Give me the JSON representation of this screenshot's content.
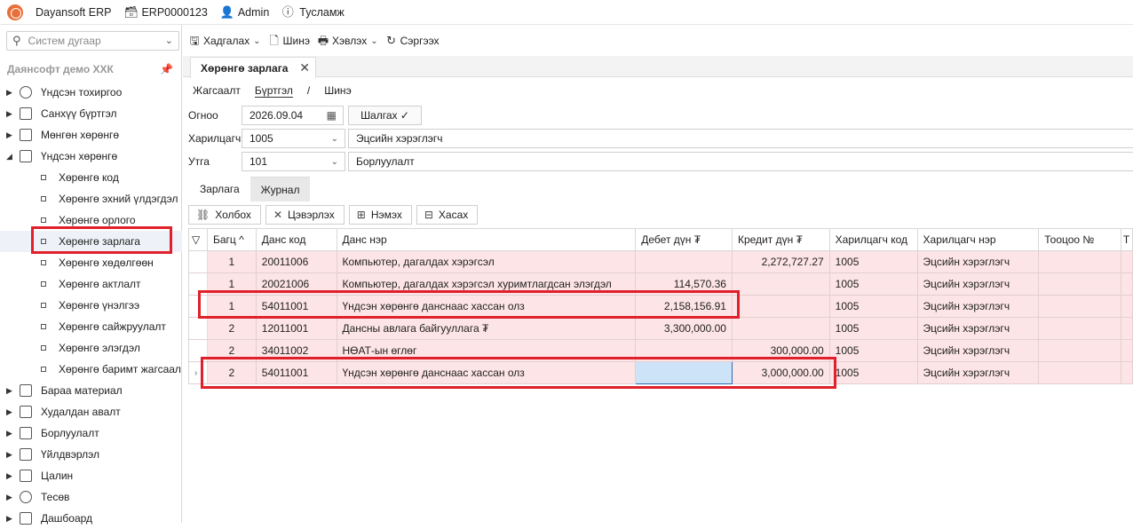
{
  "topbar": {
    "app": "Dayansoft ERP",
    "db": "ERP0000123",
    "user": "Admin",
    "help": "Тусламж"
  },
  "sidebar": {
    "search_placeholder": "Систем дугаар",
    "company": "Даянсофт демо ХХК",
    "items": [
      {
        "label": "Үндсэн тохиргоо"
      },
      {
        "label": "Санхүү бүртгэл"
      },
      {
        "label": "Мөнгөн хөрөнгө"
      },
      {
        "label": "Үндсэн хөрөнгө"
      }
    ],
    "children": [
      {
        "label": "Хөрөнгө код"
      },
      {
        "label": "Хөрөнгө эхний үлдэгдэл"
      },
      {
        "label": "Хөрөнгө орлого"
      },
      {
        "label": "Хөрөнгө зарлага"
      },
      {
        "label": "Хөрөнгө хөдөлгөөн"
      },
      {
        "label": "Хөрөнгө актлалт"
      },
      {
        "label": "Хөрөнгө үнэлгээ"
      },
      {
        "label": "Хөрөнгө сайжруулалт"
      },
      {
        "label": "Хөрөнгө элэгдэл"
      },
      {
        "label": "Хөрөнгө баримт жагсаал"
      }
    ],
    "items2": [
      {
        "label": "Бараа материал"
      },
      {
        "label": "Худалдан авалт"
      },
      {
        "label": "Борлуулалт"
      },
      {
        "label": "Үйлдвэрлэл"
      },
      {
        "label": "Цалин"
      },
      {
        "label": "Тесөв"
      },
      {
        "label": "Дашбоард"
      }
    ]
  },
  "toolbar": {
    "save": "Хадгалах",
    "new": "Шинэ",
    "print": "Хэвлэх",
    "refresh": "Сэргээх"
  },
  "doc_tab": "Хөрөнгө зарлага",
  "crumbs": {
    "list": "Жагсаалт",
    "entry": "Бүртгэл",
    "sep": "/",
    "new": "Шинэ"
  },
  "form": {
    "date_label": "Огноо",
    "date_value": "2026.09.04",
    "check_label": "Шалгах",
    "customer_label": "Харилцагч",
    "customer_code": "1005",
    "customer_name": "Эцсийн хэрэглэгч",
    "line_label": "Утга",
    "line_code": "101",
    "line_name": "Борлуулалт"
  },
  "subtabs": {
    "expense": "Зарлага",
    "journal": "Журнал"
  },
  "grid_tools": {
    "link": "Холбох",
    "clear": "Цэвэрлэх",
    "add": "Нэмэх",
    "remove": "Хасах"
  },
  "grid": {
    "headers": [
      "Багц",
      "Данс код",
      "Данс нэр",
      "Дебет дүн ₮",
      "Кредит дүн ₮",
      "Харилцагч код",
      "Харилцагч нэр",
      "Тооцоо №",
      "Т"
    ],
    "rows": [
      {
        "batch": "1",
        "code": "20011006",
        "name": "Компьютер, дагалдах хэрэгсэл",
        "debit": "",
        "credit": "2,272,727.27",
        "cust": "1005",
        "cust_name": "Эцсийн хэрэглэгч"
      },
      {
        "batch": "1",
        "code": "20021006",
        "name": "Компьютер, дагалдах хэрэгсэл хуримтлагдсан элэгдэл",
        "debit": "114,570.36",
        "credit": "",
        "cust": "1005",
        "cust_name": "Эцсийн хэрэглэгч"
      },
      {
        "batch": "1",
        "code": "54011001",
        "name": "Үндсэн хөрөнгө данснаас хассан олз",
        "debit": "2,158,156.91",
        "credit": "",
        "cust": "1005",
        "cust_name": "Эцсийн хэрэглэгч"
      },
      {
        "batch": "2",
        "code": "12011001",
        "name": "Дансны авлага байгууллага ₮",
        "debit": "3,300,000.00",
        "credit": "",
        "cust": "1005",
        "cust_name": "Эцсийн хэрэглэгч"
      },
      {
        "batch": "2",
        "code": "34011002",
        "name": "НӨАТ-ын өглөг",
        "debit": "",
        "credit": "300,000.00",
        "cust": "1005",
        "cust_name": "Эцсийн хэрэглэгч"
      },
      {
        "batch": "2",
        "code": "54011001",
        "name": "Үндсэн хөрөнгө данснаас хассан олз",
        "debit": "",
        "credit": "3,000,000.00",
        "cust": "1005",
        "cust_name": "Эцсийн хэрэглэгч"
      }
    ]
  },
  "colors": {
    "row_bg": "#fde4e6",
    "highlight": "#e0202a",
    "selected_cell": "#cde3f7"
  }
}
